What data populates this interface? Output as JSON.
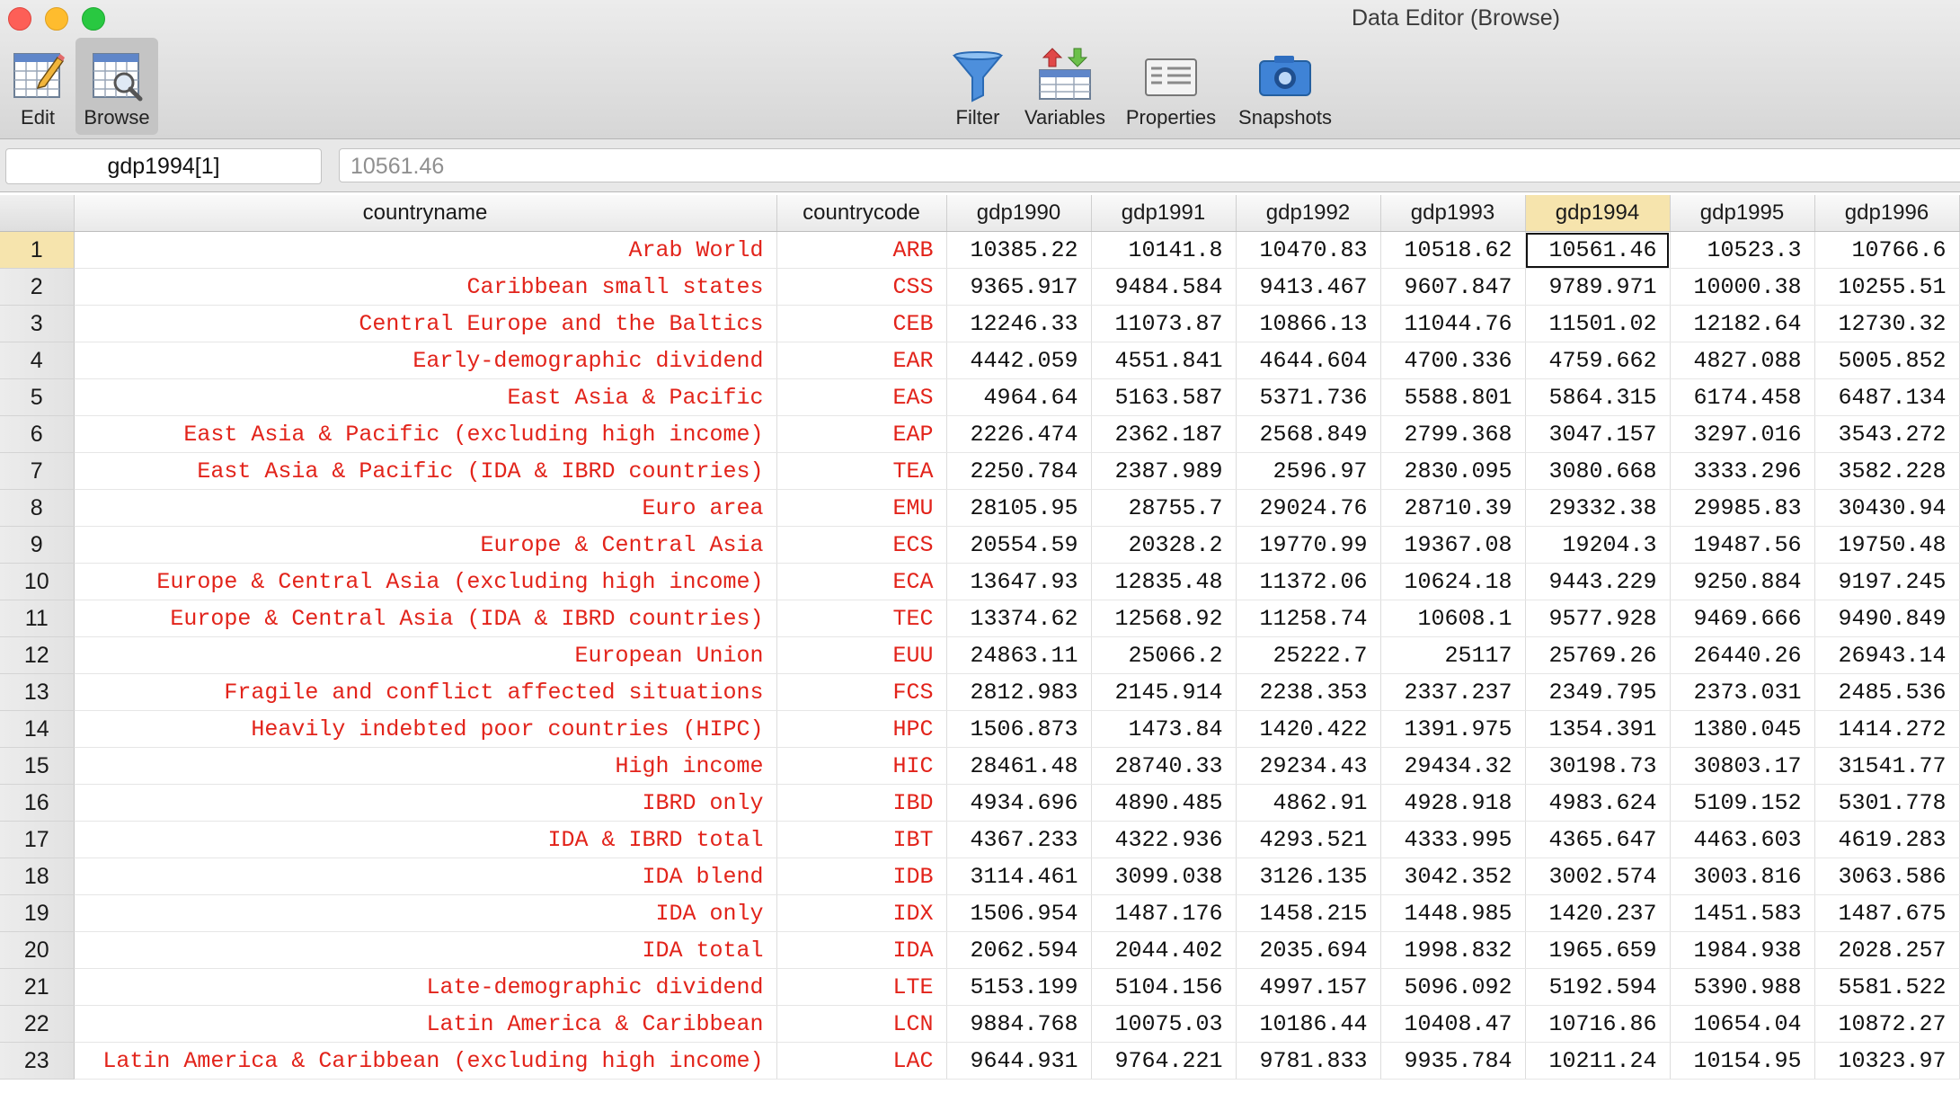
{
  "window": {
    "title": "Data Editor (Browse)"
  },
  "toolbar": {
    "edit_label": "Edit",
    "browse_label": "Browse",
    "filter_label": "Filter",
    "variables_label": "Variables",
    "properties_label": "Properties",
    "snapshots_label": "Snapshots"
  },
  "cellbar": {
    "name": "gdp1994[1]",
    "value": "10561.46"
  },
  "grid": {
    "columns": [
      "countryname",
      "countrycode",
      "gdp1990",
      "gdp1991",
      "gdp1992",
      "gdp1993",
      "gdp1994",
      "gdp1995",
      "gdp1996"
    ],
    "selected_column": "gdp1994",
    "selected_row": 1,
    "rows": [
      [
        "1",
        "Arab World",
        "ARB",
        "10385.22",
        "10141.8",
        "10470.83",
        "10518.62",
        "10561.46",
        "10523.3",
        "10766.6"
      ],
      [
        "2",
        "Caribbean small states",
        "CSS",
        "9365.917",
        "9484.584",
        "9413.467",
        "9607.847",
        "9789.971",
        "10000.38",
        "10255.51"
      ],
      [
        "3",
        "Central Europe and the Baltics",
        "CEB",
        "12246.33",
        "11073.87",
        "10866.13",
        "11044.76",
        "11501.02",
        "12182.64",
        "12730.32"
      ],
      [
        "4",
        "Early-demographic dividend",
        "EAR",
        "4442.059",
        "4551.841",
        "4644.604",
        "4700.336",
        "4759.662",
        "4827.088",
        "5005.852"
      ],
      [
        "5",
        "East Asia & Pacific",
        "EAS",
        "4964.64",
        "5163.587",
        "5371.736",
        "5588.801",
        "5864.315",
        "6174.458",
        "6487.134"
      ],
      [
        "6",
        "East Asia & Pacific (excluding high income)",
        "EAP",
        "2226.474",
        "2362.187",
        "2568.849",
        "2799.368",
        "3047.157",
        "3297.016",
        "3543.272"
      ],
      [
        "7",
        "East Asia & Pacific (IDA & IBRD countries)",
        "TEA",
        "2250.784",
        "2387.989",
        "2596.97",
        "2830.095",
        "3080.668",
        "3333.296",
        "3582.228"
      ],
      [
        "8",
        "Euro area",
        "EMU",
        "28105.95",
        "28755.7",
        "29024.76",
        "28710.39",
        "29332.38",
        "29985.83",
        "30430.94"
      ],
      [
        "9",
        "Europe & Central Asia",
        "ECS",
        "20554.59",
        "20328.2",
        "19770.99",
        "19367.08",
        "19204.3",
        "19487.56",
        "19750.48"
      ],
      [
        "10",
        "Europe & Central Asia (excluding high income)",
        "ECA",
        "13647.93",
        "12835.48",
        "11372.06",
        "10624.18",
        "9443.229",
        "9250.884",
        "9197.245"
      ],
      [
        "11",
        "Europe & Central Asia (IDA & IBRD countries)",
        "TEC",
        "13374.62",
        "12568.92",
        "11258.74",
        "10608.1",
        "9577.928",
        "9469.666",
        "9490.849"
      ],
      [
        "12",
        "European Union",
        "EUU",
        "24863.11",
        "25066.2",
        "25222.7",
        "25117",
        "25769.26",
        "26440.26",
        "26943.14"
      ],
      [
        "13",
        "Fragile and conflict affected situations",
        "FCS",
        "2812.983",
        "2145.914",
        "2238.353",
        "2337.237",
        "2349.795",
        "2373.031",
        "2485.536"
      ],
      [
        "14",
        "Heavily indebted poor countries (HIPC)",
        "HPC",
        "1506.873",
        "1473.84",
        "1420.422",
        "1391.975",
        "1354.391",
        "1380.045",
        "1414.272"
      ],
      [
        "15",
        "High income",
        "HIC",
        "28461.48",
        "28740.33",
        "29234.43",
        "29434.32",
        "30198.73",
        "30803.17",
        "31541.77"
      ],
      [
        "16",
        "IBRD only",
        "IBD",
        "4934.696",
        "4890.485",
        "4862.91",
        "4928.918",
        "4983.624",
        "5109.152",
        "5301.778"
      ],
      [
        "17",
        "IDA & IBRD total",
        "IBT",
        "4367.233",
        "4322.936",
        "4293.521",
        "4333.995",
        "4365.647",
        "4463.603",
        "4619.283"
      ],
      [
        "18",
        "IDA blend",
        "IDB",
        "3114.461",
        "3099.038",
        "3126.135",
        "3042.352",
        "3002.574",
        "3003.816",
        "3063.586"
      ],
      [
        "19",
        "IDA only",
        "IDX",
        "1506.954",
        "1487.176",
        "1458.215",
        "1448.985",
        "1420.237",
        "1451.583",
        "1487.675"
      ],
      [
        "20",
        "IDA total",
        "IDA",
        "2062.594",
        "2044.402",
        "2035.694",
        "1998.832",
        "1965.659",
        "1984.938",
        "2028.257"
      ],
      [
        "21",
        "Late-demographic dividend",
        "LTE",
        "5153.199",
        "5104.156",
        "4997.157",
        "5096.092",
        "5192.594",
        "5390.988",
        "5581.522"
      ],
      [
        "22",
        "Latin America & Caribbean",
        "LCN",
        "9884.768",
        "10075.03",
        "10186.44",
        "10408.47",
        "10716.86",
        "10654.04",
        "10872.27"
      ],
      [
        "23",
        "Latin America & Caribbean (excluding high income)",
        "LAC",
        "9644.931",
        "9764.221",
        "9781.833",
        "9935.784",
        "10211.24",
        "10154.95",
        "10323.97"
      ]
    ]
  },
  "colors": {
    "string_text": "#e2231a",
    "selection_highlight": "#f6e4ad"
  }
}
